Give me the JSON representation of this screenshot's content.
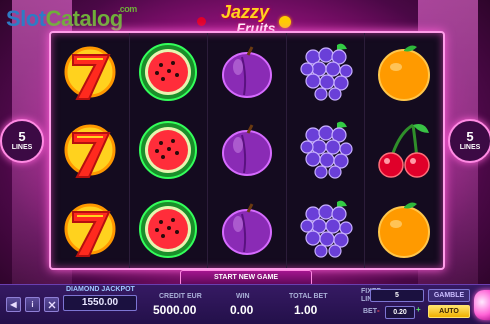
{
  "watermark": {
    "part1": "Slot",
    "part2": "Catalog",
    "suffix": ".com"
  },
  "logo": {
    "line1": "Jazzy",
    "line2": "Fruits"
  },
  "lines_left": {
    "count": "5",
    "label": "LINES"
  },
  "lines_right": {
    "count": "5",
    "label": "LINES"
  },
  "reels": [
    [
      "seven",
      "seven",
      "seven"
    ],
    [
      "watermelon",
      "watermelon",
      "watermelon"
    ],
    [
      "plum",
      "plum",
      "plum"
    ],
    [
      "grapes",
      "grapes",
      "grapes"
    ],
    [
      "orange",
      "cherries",
      "orange"
    ]
  ],
  "start_new_game": "START NEW GAME",
  "jackpot": {
    "label": "DIAMOND JACKPOT",
    "value": "1550.00"
  },
  "credit": {
    "label": "CREDIT EUR",
    "value": "5000.00"
  },
  "win": {
    "label": "WIN",
    "value": "0.00"
  },
  "total_bet": {
    "label": "TOTAL BET",
    "value": "1.00"
  },
  "fixed_lines": {
    "label": "FIXED LINES",
    "value": "5"
  },
  "bet": {
    "label": "BET",
    "value": "0.20",
    "minus": "-",
    "plus": "+"
  },
  "gamble_label": "GAMBLE",
  "auto_label": "AUTO",
  "small_buttons": {
    "info": "i",
    "sound": "◀"
  },
  "colors": {
    "accent": "#ff5fd6",
    "panel": "#2a1554",
    "auto": "#f0b000"
  }
}
